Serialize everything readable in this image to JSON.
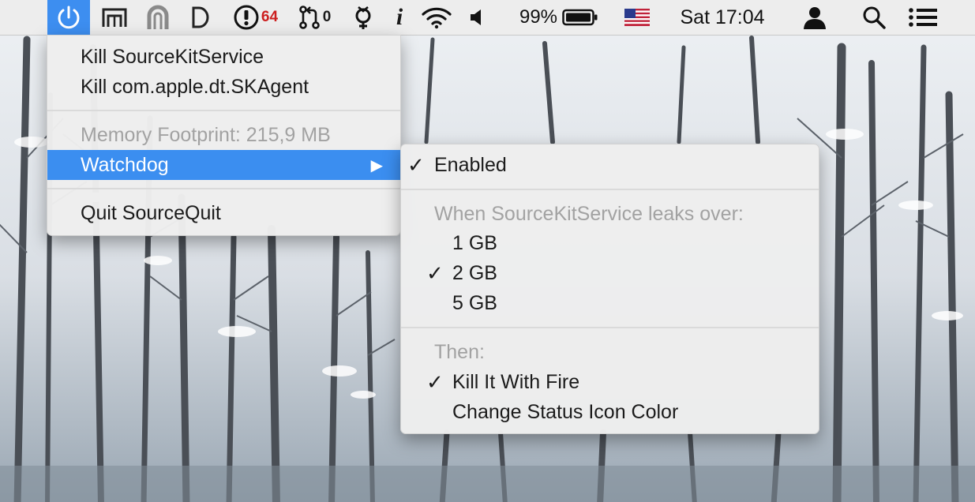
{
  "menubar": {
    "badge_count": "64",
    "pr_count": "0",
    "info_glyph": "i",
    "battery_percent": "99%",
    "clock": "Sat 17:04",
    "icons": [
      "power-icon",
      "hdd-monitor-icon",
      "arch-icon",
      "d-letter-icon",
      "exclamation-icon",
      "git-pull-request-icon",
      "gender-icon",
      "info-icon",
      "wifi-icon",
      "speaker-icon",
      "battery-icon",
      "us-flag-icon",
      "user-icon",
      "search-icon",
      "list-icon"
    ],
    "colors": {
      "status_active": "#3d8ef0",
      "badge": "#cc1f1f"
    }
  },
  "main_menu": {
    "kill_service": "Kill SourceKitService",
    "kill_agent": "Kill com.apple.dt.SKAgent",
    "memory_footprint": "Memory Footprint: 215,9 MB",
    "watchdog": "Watchdog",
    "quit": "Quit SourceQuit"
  },
  "watchdog_menu": {
    "enabled": "Enabled",
    "enabled_checked": true,
    "leaks_header": "When SourceKitService leaks over:",
    "thresholds": [
      {
        "label": "1 GB",
        "checked": false
      },
      {
        "label": "2 GB",
        "checked": true
      },
      {
        "label": "5 GB",
        "checked": false
      }
    ],
    "then_header": "Then:",
    "actions": [
      {
        "label": "Kill It With Fire",
        "checked": true
      },
      {
        "label": "Change Status Icon Color",
        "checked": false
      }
    ],
    "check_glyph": "✓",
    "colors": {
      "highlight": "#3b8ef0"
    }
  }
}
